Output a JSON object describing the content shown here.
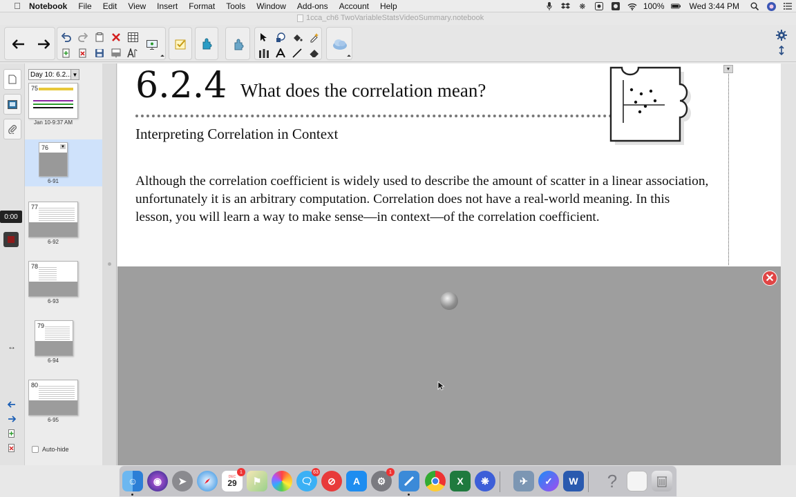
{
  "menubar": {
    "app_name": "Notebook",
    "items": [
      "File",
      "Edit",
      "View",
      "Insert",
      "Format",
      "Tools",
      "Window",
      "Add-ons",
      "Account",
      "Help"
    ],
    "battery": "100%",
    "clock": "Wed 3:44 PM"
  },
  "window": {
    "title": "1cca_ch6 TwoVariableStatsVideoSummary.notebook"
  },
  "sidebar": {
    "timer": "0:00",
    "group_select": "Day 10: 6.2...",
    "autohide_label": "Auto-hide",
    "pages": [
      {
        "number": "75",
        "caption": "Jan 10-9:37 AM",
        "selected": false
      },
      {
        "number": "76",
        "caption": "6-91",
        "selected": true
      },
      {
        "number": "77",
        "caption": "6-92",
        "selected": false
      },
      {
        "number": "78",
        "caption": "6-93",
        "selected": false
      },
      {
        "number": "79",
        "caption": "6-94",
        "selected": false
      },
      {
        "number": "80",
        "caption": "6-95",
        "selected": false
      }
    ]
  },
  "page": {
    "section_number": "6.2.4",
    "section_title": "What does the correlation mean?",
    "subheading": "Interpreting Correlation in Context",
    "body": "Although the correlation coefficient is widely used to describe the amount of scatter in a linear association, unfortunately it is an arbitrary computation.  Correlation does not have a real-world meaning.  In this lesson, you will learn a way to make sense—in context—of the correlation coefficient."
  },
  "dock": {
    "calendar_month": "DEC",
    "calendar_day": "29",
    "calendar_badge": "1",
    "messages_badge": "63",
    "prefs_badge": "1"
  },
  "colors": {
    "accent": "#1c5fb5",
    "selected_thumb": "#cfe2fb",
    "close": "#e04545",
    "shade": "#9e9e9e"
  }
}
